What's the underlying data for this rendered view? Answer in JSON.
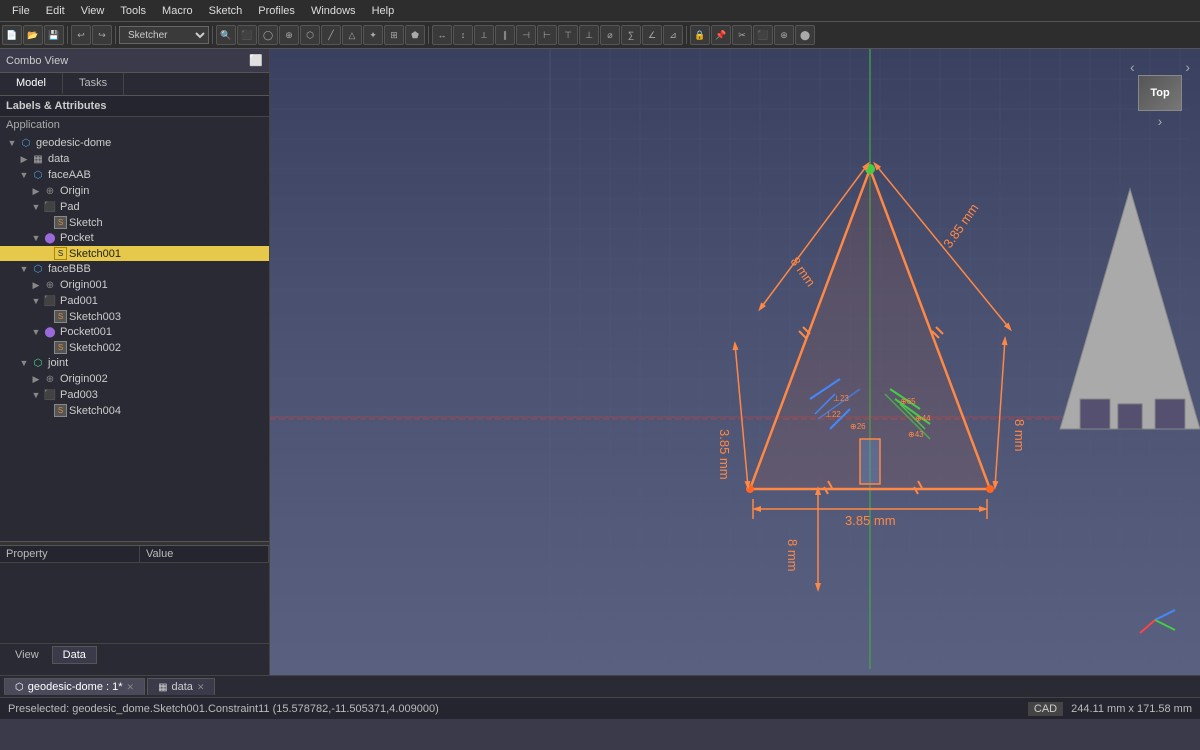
{
  "app": {
    "title": "Sketcher"
  },
  "menubar": {
    "items": [
      "File",
      "Edit",
      "View",
      "Tools",
      "Macro",
      "Sketch",
      "Profiles",
      "Windows",
      "Help"
    ]
  },
  "combo_view": {
    "header": "Combo View",
    "tabs": [
      "Model",
      "Tasks"
    ]
  },
  "labels": {
    "header": "Labels & Attributes",
    "app_label": "Application"
  },
  "tree": {
    "items": [
      {
        "id": "geodesic-dome",
        "label": "geodesic-dome",
        "indent": 0,
        "icon": "body",
        "expanded": true,
        "arrow": "▼"
      },
      {
        "id": "data",
        "label": "data",
        "indent": 1,
        "icon": "data",
        "expanded": false,
        "arrow": "▶"
      },
      {
        "id": "faceAAB",
        "label": "faceAAB",
        "indent": 1,
        "icon": "body",
        "expanded": true,
        "arrow": "▼"
      },
      {
        "id": "origin",
        "label": "Origin",
        "indent": 2,
        "icon": "origin",
        "expanded": false,
        "arrow": "▶"
      },
      {
        "id": "pad",
        "label": "Pad",
        "indent": 2,
        "icon": "pad",
        "expanded": true,
        "arrow": "▼"
      },
      {
        "id": "sketch",
        "label": "Sketch",
        "indent": 3,
        "icon": "sketch",
        "expanded": false,
        "arrow": ""
      },
      {
        "id": "pocket",
        "label": "Pocket",
        "indent": 2,
        "icon": "pocket",
        "expanded": true,
        "arrow": "▼"
      },
      {
        "id": "sketch001",
        "label": "Sketch001",
        "indent": 3,
        "icon": "sketch-selected",
        "expanded": false,
        "arrow": "",
        "selected": true
      },
      {
        "id": "faceBBB",
        "label": "faceBBB",
        "indent": 1,
        "icon": "body",
        "expanded": true,
        "arrow": "▼"
      },
      {
        "id": "origin001",
        "label": "Origin001",
        "indent": 2,
        "icon": "origin",
        "expanded": false,
        "arrow": "▶"
      },
      {
        "id": "pad001",
        "label": "Pad001",
        "indent": 2,
        "icon": "pad",
        "expanded": true,
        "arrow": "▼"
      },
      {
        "id": "sketch003",
        "label": "Sketch003",
        "indent": 3,
        "icon": "sketch",
        "expanded": false,
        "arrow": ""
      },
      {
        "id": "pocket001",
        "label": "Pocket001",
        "indent": 2,
        "icon": "pocket",
        "expanded": true,
        "arrow": "▼"
      },
      {
        "id": "sketch002",
        "label": "Sketch002",
        "indent": 3,
        "icon": "sketch",
        "expanded": false,
        "arrow": ""
      },
      {
        "id": "joint",
        "label": "joint",
        "indent": 1,
        "icon": "joint",
        "expanded": true,
        "arrow": "▼"
      },
      {
        "id": "origin002",
        "label": "Origin002",
        "indent": 2,
        "icon": "origin",
        "expanded": false,
        "arrow": "▶"
      },
      {
        "id": "pad003",
        "label": "Pad003",
        "indent": 2,
        "icon": "pad",
        "expanded": true,
        "arrow": "▼"
      },
      {
        "id": "sketch004",
        "label": "Sketch004",
        "indent": 3,
        "icon": "sketch",
        "expanded": false,
        "arrow": ""
      }
    ]
  },
  "property": {
    "col1": "Property",
    "col2": "Value",
    "tabs": [
      "View",
      "Data"
    ]
  },
  "tabs": [
    {
      "id": "geodesic-tab",
      "label": "geodesic-dome : 1*",
      "icon": "model",
      "active": true
    },
    {
      "id": "data-tab",
      "label": "data",
      "icon": "spreadsheet",
      "active": false
    }
  ],
  "statusbar": {
    "preselected": "Preselected: geodesic_dome.Sketch001.Constraint11 (15.578782,-11.505371,4.009000)",
    "cad": "CAD",
    "dimensions": "244.11 mm x 171.58 mm"
  },
  "nav_cube": {
    "label": "Top"
  },
  "dimensions": {
    "d1": "3.85 mm",
    "d2": "8 mm",
    "d3": "8 mm",
    "d4": "3.85 mm",
    "d5": "3.85 mm",
    "d6": "8 mm"
  }
}
